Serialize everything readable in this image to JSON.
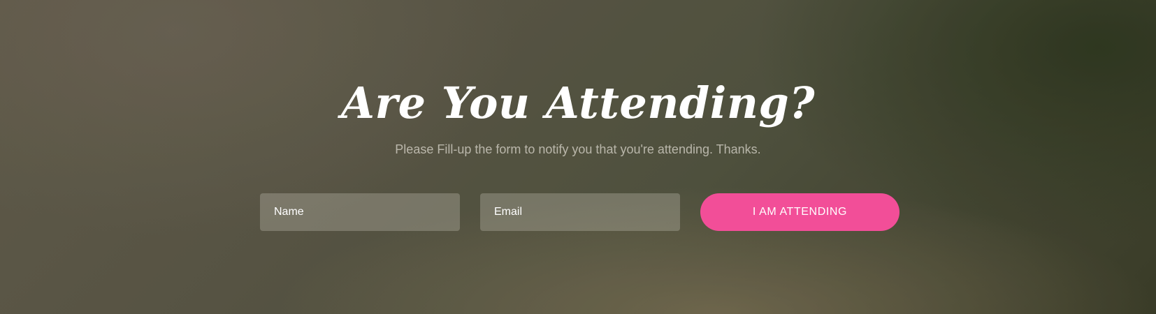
{
  "rsvp": {
    "title": "Are You Attending?",
    "subtitle": "Please Fill-up the form to notify you that you're attending. Thanks.",
    "name_placeholder": "Name",
    "email_placeholder": "Email",
    "submit_label": "I AM ATTENDING"
  },
  "colors": {
    "accent_button": "#f24e98",
    "title_text": "#ffffff"
  }
}
